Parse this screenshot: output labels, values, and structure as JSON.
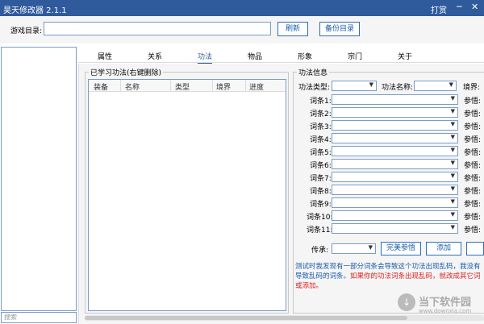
{
  "titlebar": {
    "title": "昊天修改器   2.1.1",
    "reward": "打赏",
    "min": "─",
    "close": "✕"
  },
  "toolbar": {
    "game_dir_label": "游戏目录:",
    "game_dir_value": "",
    "refresh": "刷新",
    "backup": "备份目录"
  },
  "left": {
    "search_placeholder": "搜索"
  },
  "tabs": [
    "属性",
    "关系",
    "功法",
    "物品",
    "形象",
    "宗门",
    "关于"
  ],
  "active_tab": "功法",
  "learned": {
    "title": "已学习功法(右键删除)",
    "columns": [
      "装备",
      "名称",
      "类型",
      "境界",
      "进度"
    ]
  },
  "info": {
    "title": "功法信息",
    "type_label": "功法类型:",
    "name_label": "功法名称:",
    "realm_label": "境界:",
    "entries": [
      "词条1:",
      "词条2:",
      "词条3:",
      "词条4:",
      "词条5:",
      "词条6:",
      "词条7:",
      "词条8:",
      "词条9:",
      "词条10:",
      "词条11:"
    ],
    "param_label": "参悟:",
    "inherit_label": "传承:",
    "perfect_button": "完美参悟",
    "add_button": "添加"
  },
  "note": {
    "blue1": "测试时我发现有一部分词条会导致这个功法出现乱码，我没有",
    "blue2": "导致乱码的词条。",
    "red1": "如果你的功法词条出现乱码，就改成其它词",
    "red2": "或添加。"
  },
  "watermark": {
    "line1": "当下软件园",
    "line2": "www.downxia.com"
  }
}
